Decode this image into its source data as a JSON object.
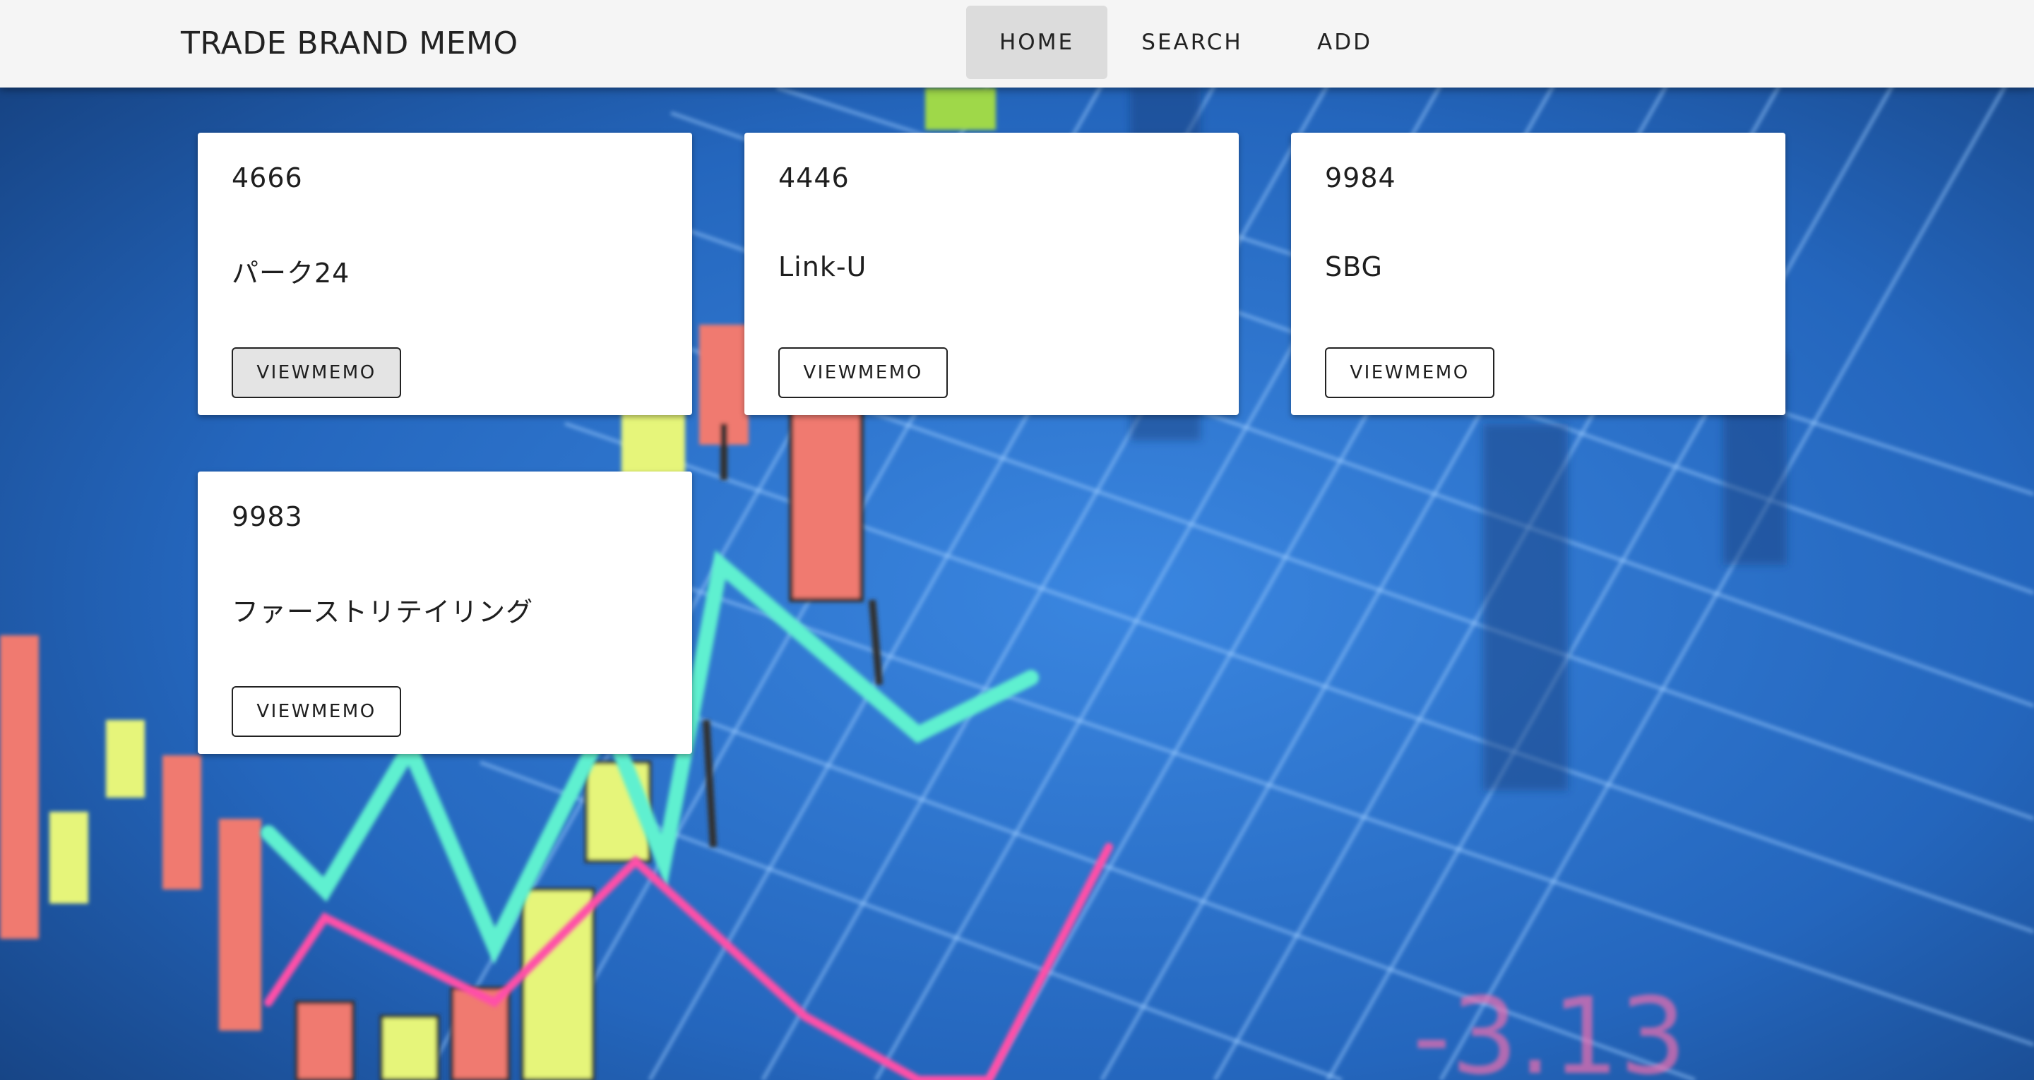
{
  "app": {
    "title": "TRADE BRAND MEMO"
  },
  "nav": {
    "items": [
      {
        "label": "HOME",
        "active": true
      },
      {
        "label": "SEARCH",
        "active": false
      },
      {
        "label": "ADD",
        "active": false
      }
    ]
  },
  "cards": [
    {
      "code": "4666",
      "name": "パーク24",
      "button": "VIEWMEMO"
    },
    {
      "code": "4446",
      "name": "Link-U",
      "button": "VIEWMEMO"
    },
    {
      "code": "9984",
      "name": "SBG",
      "button": "VIEWMEMO"
    },
    {
      "code": "9983",
      "name": "ファーストリテイリング",
      "button": "VIEWMEMO"
    }
  ],
  "background": {
    "label": "-3.13",
    "colors": {
      "base": "#1f5fae",
      "grid": "#8fc3ff",
      "up": "#e6f57a",
      "down": "#f07a70",
      "line_cyan": "#5ff0d0",
      "line_pink": "#ff4fa8"
    }
  },
  "colors": {
    "appbar": "#f5f5f5",
    "nav_active": "#dcdcdc",
    "card": "#ffffff"
  }
}
